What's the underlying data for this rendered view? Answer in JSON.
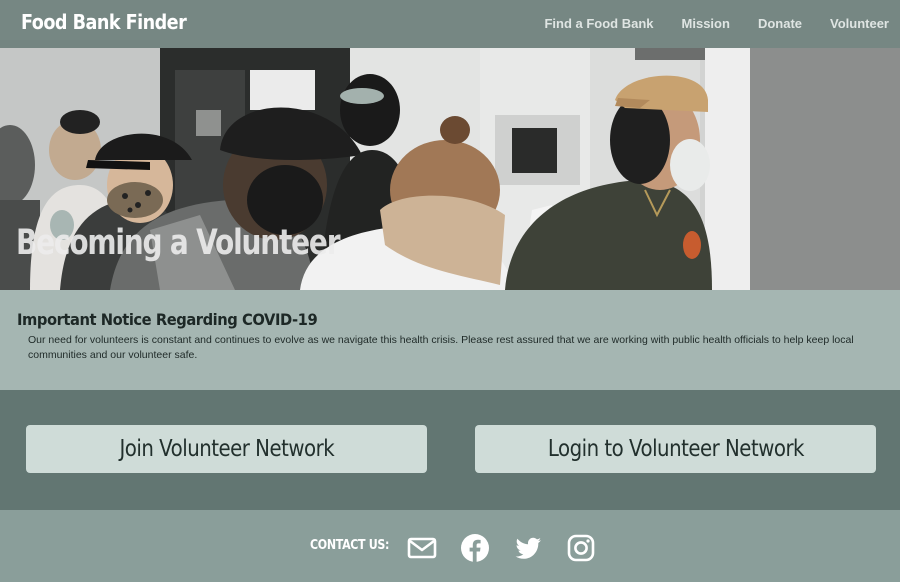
{
  "nav": {
    "brand": "Food Bank Finder",
    "links": [
      {
        "label": "Find a Food Bank"
      },
      {
        "label": "Mission"
      },
      {
        "label": "Donate"
      },
      {
        "label": "Volunteer"
      }
    ]
  },
  "hero": {
    "title": "Becoming a Volunteer"
  },
  "notice": {
    "heading": "Important Notice Regarding COVID-19",
    "body": "Our need for volunteers is constant and continues to evolve as we navigate this health crisis. Please rest assured that we are working with public health officials to help keep local communities and our volunteer safe."
  },
  "actions": {
    "join_label": "Join Volunteer Network",
    "login_label": "Login to Volunteer Network"
  },
  "footer": {
    "contact_label": "CONTACT US:",
    "icons": [
      "envelope-icon",
      "facebook-icon",
      "twitter-icon",
      "instagram-icon"
    ]
  },
  "colors": {
    "nav_bg": "#627672",
    "notice_bg": "#a5b6b2",
    "band_bg": "#627672",
    "footer_bg": "#8a9e9a",
    "button_bg": "#cfdcd8"
  }
}
